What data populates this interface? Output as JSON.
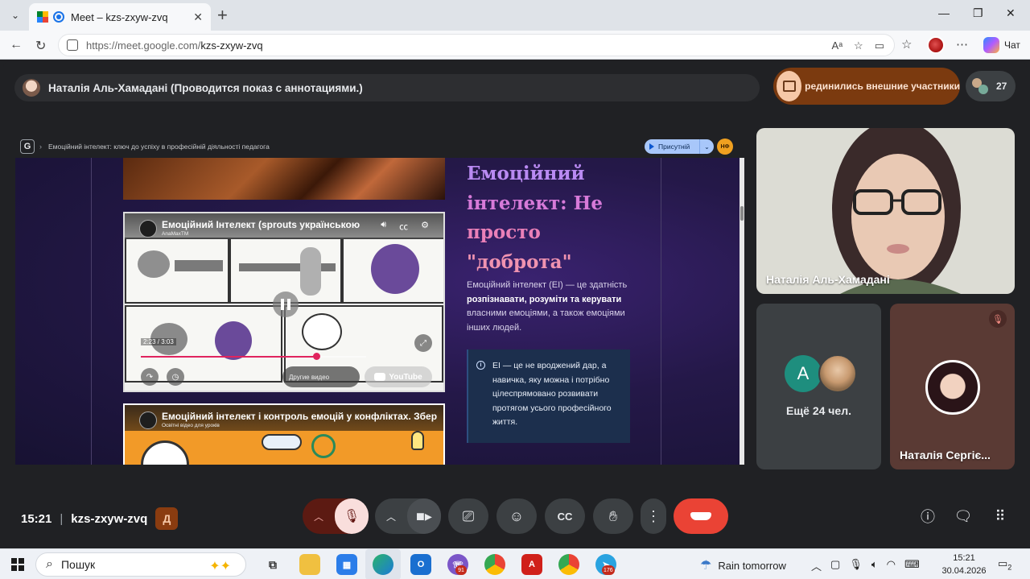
{
  "browser": {
    "tab_title": "Meet – kzs-zxyw-zvq",
    "url_host": "https://meet.google.com/",
    "url_path": "kzs-zxyw-zvq",
    "chat_label": "Чат"
  },
  "meet": {
    "presenter_banner": "Наталія Аль-Хамадані (Проводится показ с аннотациями.)",
    "external_notice": "рединились внешние участники",
    "participant_count": "27",
    "time": "15:21",
    "meeting_code": "kzs-zxyw-zvq"
  },
  "shared_screen": {
    "breadcrumb": "Емоційний інтелект: ключ до успіху в професійній діяльності педагога",
    "present_label": "Присутній",
    "avatar_initials": "НФ",
    "video1": {
      "title": "Емоційний Інтелект (sprouts українською",
      "channel": "AnaMaxTM",
      "time": "2:23 / 3:03",
      "progress": 0.78,
      "other_videos": "Другие видео",
      "youtube": "YouTube"
    },
    "video2": {
      "title": "Емоційний інтелект і контроль емоцій у конфліктах. Збер",
      "channel": "Освітні відео для уроків"
    },
    "heading_lines": [
      "Емоційний",
      "інтелект: Не",
      "просто",
      "\"доброта\""
    ],
    "para_pre": "Емоційний інтелект (ЕІ) — це здатність ",
    "para_bold": "розпізнавати, розуміти та керувати",
    "para_post": " власними емоціями, а також емоціями інших людей.",
    "info_text": "ЕІ — це не вроджений дар, а навичка, яку можна і потрібно цілеспрямовано розвивати протягом усього професійного життя."
  },
  "participants": {
    "main_name": "Наталія Аль-Хамадані",
    "more_initial": "А",
    "more_label": "Ещё 24 чел.",
    "third_name": "Наталія Сергіє..."
  },
  "taskbar": {
    "search_placeholder": "Пошук",
    "weather": "Rain tomorrow",
    "clock_time": "15:21",
    "clock_date": "30.04.2026",
    "viber_badge": "91",
    "telegram_badge": "176",
    "notif_count": "2"
  },
  "colors": {
    "end_call": "#ea4335",
    "mic_muted_bg": "#f9dedc",
    "external_pill": "#7b3a0f",
    "heading_purple": "#b98af2",
    "heading_pink": "#ea80b8"
  }
}
